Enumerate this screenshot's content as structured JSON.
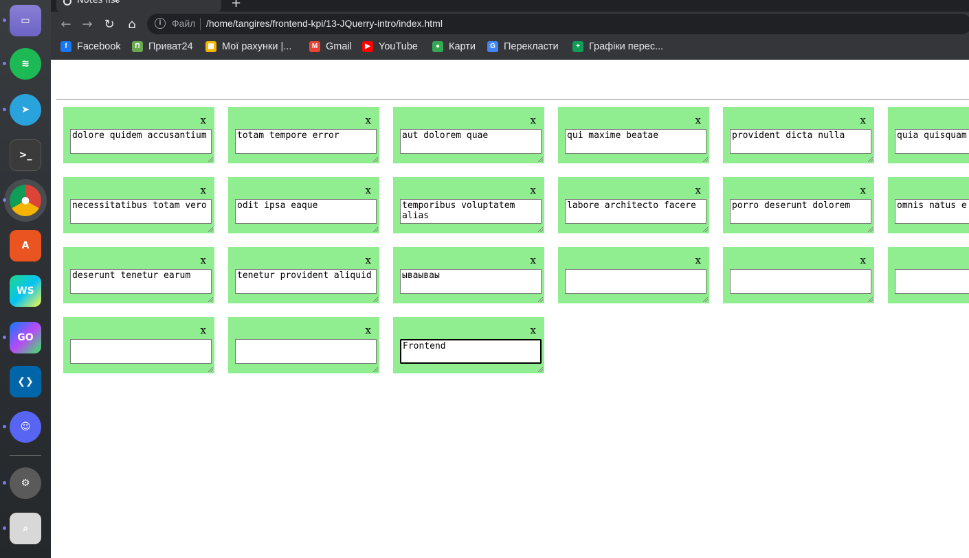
{
  "browser": {
    "tab_title": "Notes list",
    "new_tab_label": "+",
    "tab_close_label": "✕",
    "omnibox_scheme_label": "Файл",
    "url": "/home/tangires/frontend-kpi/13-JQuerry-intro/index.html",
    "bookmarks": [
      {
        "label": "Facebook",
        "icon": "facebook-icon",
        "color": "#1877f2",
        "glyph": "f"
      },
      {
        "label": "Приват24",
        "icon": "privat24-icon",
        "color": "#6aa84f",
        "glyph": "П"
      },
      {
        "label": "Мої рахунки |...",
        "icon": "accounts-icon",
        "color": "#f4b400",
        "glyph": "▦"
      },
      {
        "label": "Gmail",
        "icon": "gmail-icon",
        "color": "#ea4335",
        "glyph": "M"
      },
      {
        "label": "YouTube",
        "icon": "youtube-icon",
        "color": "#ff0000",
        "glyph": "▶"
      },
      {
        "label": "Карти",
        "icon": "maps-icon",
        "color": "#34a853",
        "glyph": "●"
      },
      {
        "label": "Перекласти",
        "icon": "translate-icon",
        "color": "#4285f4",
        "glyph": "G"
      },
      {
        "label": "Графіки перес...",
        "icon": "sheets-icon",
        "color": "#0f9d58",
        "glyph": "+"
      }
    ]
  },
  "dock": {
    "apps": [
      "files-icon",
      "spotify-icon",
      "telegram-icon",
      "terminal-icon",
      "chrome-icon",
      "app-center-icon",
      "webstorm-icon",
      "goland-icon",
      "vscode-icon",
      "discord-icon",
      "settings-icon",
      "search-icon"
    ]
  },
  "notes": {
    "close_label": "x",
    "items": [
      "dolore quidem accusantium",
      "totam tempore error",
      "aut dolorem quae",
      "qui maxime beatae",
      "provident dicta nulla",
      "quia quisquam",
      "necessitatibus totam vero",
      "odit ipsa eaque",
      "temporibus voluptatem alias",
      "labore architecto facere",
      "porro deserunt dolorem",
      "omnis natus e",
      "deserunt tenetur earum",
      "tenetur provident aliquid",
      "ываываы",
      "",
      "",
      "",
      "",
      "",
      "Frontend"
    ],
    "focused_index": 20
  }
}
